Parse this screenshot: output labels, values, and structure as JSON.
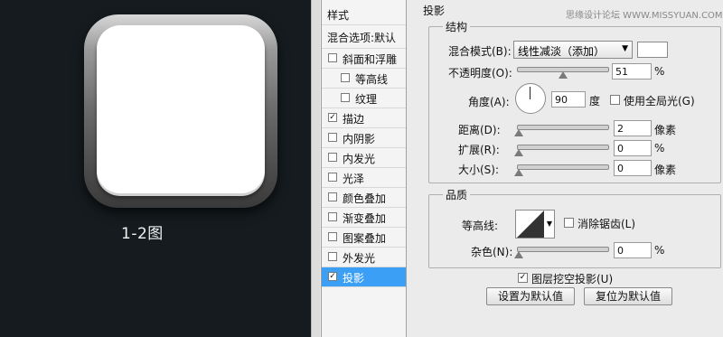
{
  "preview": {
    "caption": "1-2图"
  },
  "watermark": "思缘设计论坛  WWW.MISSYUAN.COM",
  "styles_panel": {
    "header": "样式",
    "blend_options": "混合选项:默认",
    "items": [
      {
        "label": "斜面和浮雕",
        "checked": false,
        "indent": false
      },
      {
        "label": "等高线",
        "checked": false,
        "indent": true
      },
      {
        "label": "纹理",
        "checked": false,
        "indent": true
      },
      {
        "label": "描边",
        "checked": true,
        "indent": false
      },
      {
        "label": "内阴影",
        "checked": false,
        "indent": false
      },
      {
        "label": "内发光",
        "checked": false,
        "indent": false
      },
      {
        "label": "光泽",
        "checked": false,
        "indent": false
      },
      {
        "label": "颜色叠加",
        "checked": false,
        "indent": false
      },
      {
        "label": "渐变叠加",
        "checked": false,
        "indent": false
      },
      {
        "label": "图案叠加",
        "checked": false,
        "indent": false
      },
      {
        "label": "外发光",
        "checked": false,
        "indent": false
      },
      {
        "label": "投影",
        "checked": true,
        "indent": false,
        "selected": true
      }
    ],
    "checkmark": "✓"
  },
  "drop_shadow": {
    "title": "投影",
    "structure": {
      "title": "结构",
      "blend_mode_label": "混合模式(B):",
      "blend_mode_value": "线性减淡（添加）",
      "blend_color": "#ffffff",
      "opacity_label": "不透明度(O):",
      "opacity_value": "51",
      "opacity_unit": "%",
      "opacity_level": 0.51,
      "angle_label": "角度(A):",
      "angle_value": "90",
      "angle_unit": "度",
      "global_light_label": "使用全局光(G)",
      "global_light_checked": false,
      "distance_label": "距离(D):",
      "distance_value": "2",
      "distance_unit": "像素",
      "spread_label": "扩展(R):",
      "spread_value": "0",
      "spread_unit": "%",
      "size_label": "大小(S):",
      "size_value": "0",
      "size_unit": "像素"
    },
    "quality": {
      "title": "品质",
      "contour_label": "等高线:",
      "antialias_label": "消除锯齿(L)",
      "antialias_checked": false,
      "noise_label": "杂色(N):",
      "noise_value": "0",
      "noise_unit": "%"
    },
    "knockout_label": "图层挖空投影(U)",
    "knockout_checked": true,
    "make_default": "设置为默认值",
    "reset_default": "复位为默认值"
  }
}
